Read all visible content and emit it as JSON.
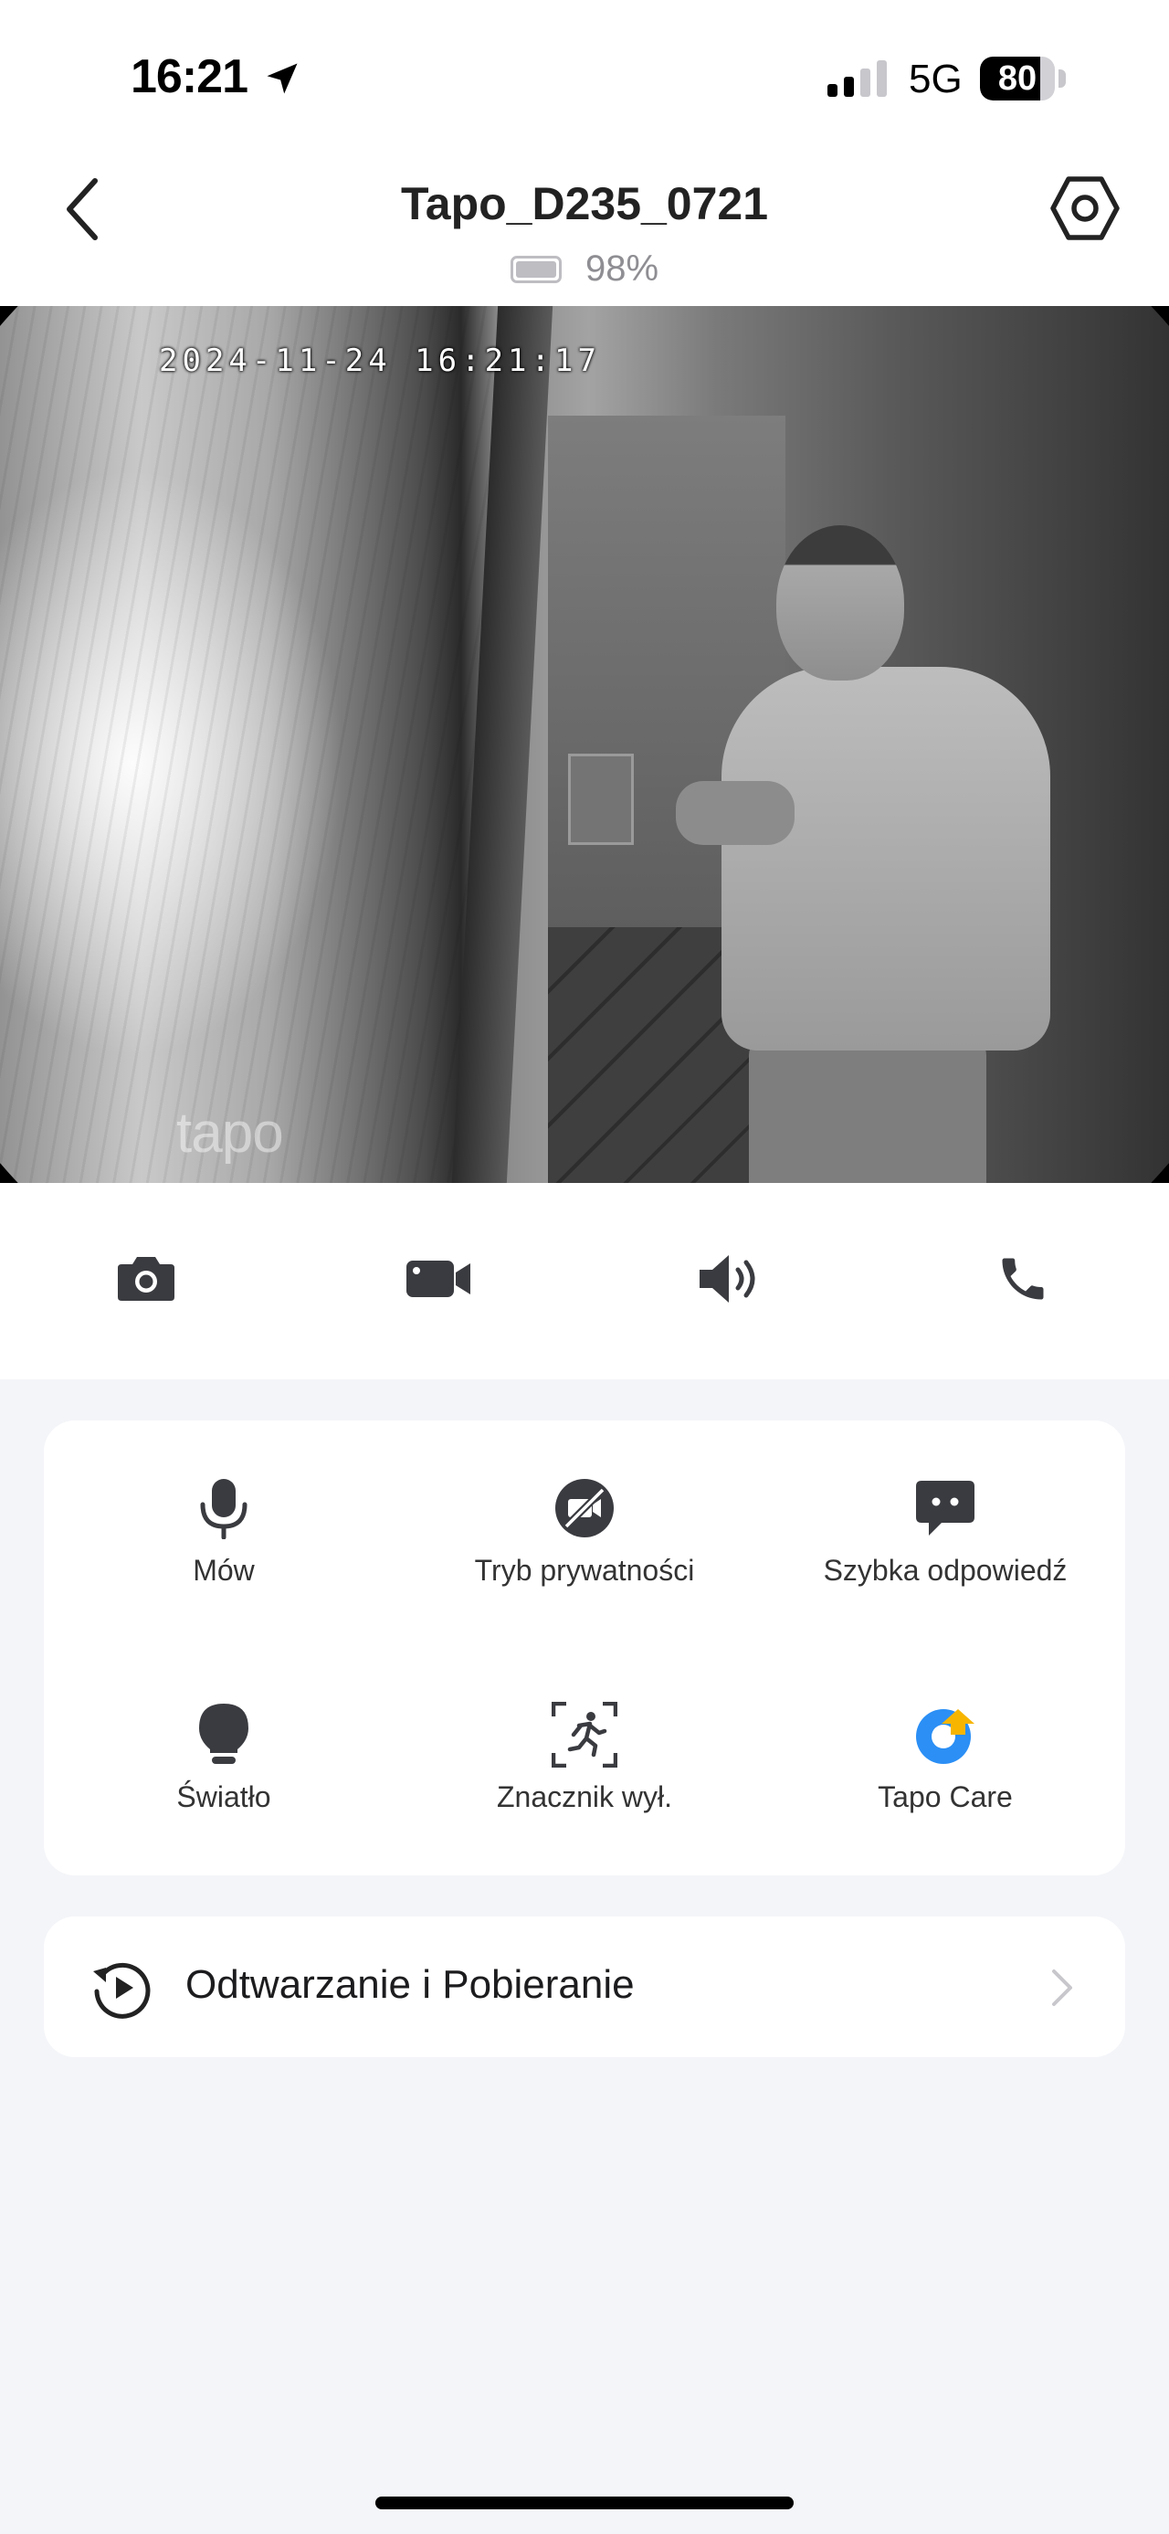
{
  "status_bar": {
    "time": "16:21",
    "network": "5G",
    "battery": "80",
    "battery_level": 0.8,
    "signal_bars_filled": 2,
    "signal_bars_total": 4
  },
  "header": {
    "title": "Tapo_D235_0721",
    "device_battery": "98%",
    "back_icon": "chevron-left-icon",
    "settings_icon": "hexagon-settings-icon"
  },
  "camera_feed": {
    "timestamp": "2024-11-24 16:21:17",
    "watermark": "tapo"
  },
  "toolbar": {
    "items": [
      {
        "icon": "camera-icon",
        "action": "snapshot"
      },
      {
        "icon": "video-camera-icon",
        "action": "record"
      },
      {
        "icon": "speaker-icon",
        "action": "sound"
      },
      {
        "icon": "phone-icon",
        "action": "call"
      }
    ]
  },
  "features": [
    {
      "label": "Mów",
      "icon": "microphone-icon"
    },
    {
      "label": "Tryb prywatności",
      "icon": "privacy-mode-icon"
    },
    {
      "label": "Szybka odpowiedź",
      "icon": "quick-reply-icon"
    },
    {
      "label": "Światło",
      "icon": "lightbulb-icon"
    },
    {
      "label": "Znacznik wył.",
      "icon": "motion-detection-icon"
    },
    {
      "label": "Tapo Care",
      "icon": "tapo-care-icon"
    }
  ],
  "playback": {
    "label": "Odtwarzanie i Pobieranie",
    "icon": "playback-history-icon"
  },
  "colors": {
    "background": "#f4f5f9",
    "icon_dark": "#3a3b40",
    "tapo_care_blue": "#2b8ff5",
    "tapo_care_yellow": "#f7b500"
  }
}
